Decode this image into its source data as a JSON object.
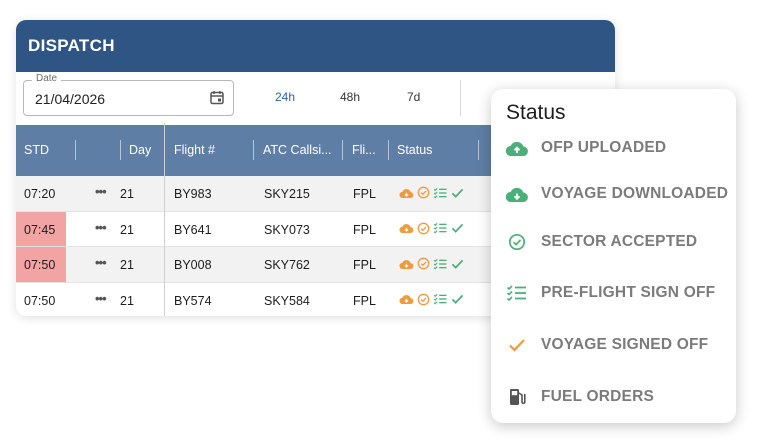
{
  "header": {
    "title": "DISPATCH"
  },
  "date_filter": {
    "label": "Date",
    "value": "21/04/2026"
  },
  "ranges": [
    {
      "label": "24h",
      "active": true
    },
    {
      "label": "48h",
      "active": false
    },
    {
      "label": "7d",
      "active": false
    }
  ],
  "table": {
    "columns": [
      "STD",
      "Day",
      "Flight #",
      "ATC Callsi...",
      "Fli...",
      "Status"
    ],
    "rows": [
      {
        "std": "07:20",
        "std_late": false,
        "day": "21",
        "flight": "BY983",
        "callsign": "SKY215",
        "plan": "FPL"
      },
      {
        "std": "07:45",
        "std_late": true,
        "day": "21",
        "flight": "BY641",
        "callsign": "SKY073",
        "plan": "FPL"
      },
      {
        "std": "07:50",
        "std_late": true,
        "day": "21",
        "flight": "BY008",
        "callsign": "SKY762",
        "plan": "FPL"
      },
      {
        "std": "07:50",
        "std_late": false,
        "day": "21",
        "flight": "BY574",
        "callsign": "SKY584",
        "plan": "FPL"
      }
    ],
    "more_actions": "•••"
  },
  "status_legend": {
    "title": "Status",
    "items": [
      {
        "label": "OFP UPLOADED",
        "icon": "cloud-upload-icon"
      },
      {
        "label": "VOYAGE DOWNLOADED",
        "icon": "cloud-download-icon"
      },
      {
        "label": "SECTOR ACCEPTED",
        "icon": "check-circle-icon"
      },
      {
        "label": "PRE-FLIGHT SIGN OFF",
        "icon": "checklist-icon"
      },
      {
        "label": "VOYAGE SIGNED OFF",
        "icon": "checkmark-icon"
      },
      {
        "label": "FUEL ORDERS",
        "icon": "fuel-pump-icon"
      }
    ]
  },
  "colors": {
    "header_bg": "#2f5584",
    "table_header_bg": "#5f7ea5",
    "late_std": "#f2a3a3",
    "status_green": "#4caf7a",
    "status_orange": "#ef9a3c",
    "active_range": "#2a63b5"
  }
}
